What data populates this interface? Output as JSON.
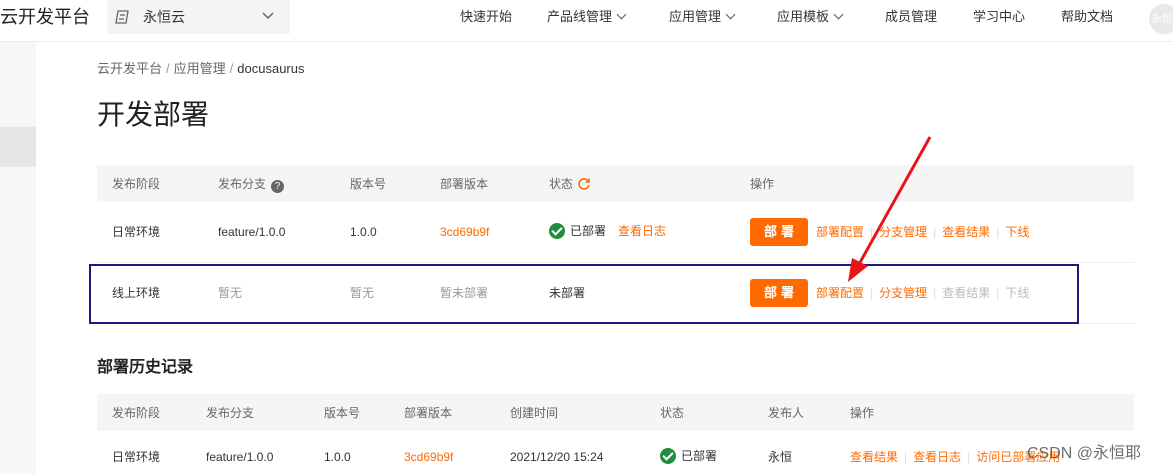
{
  "topbar": {
    "brand": "云开发平台",
    "tenant": "永恒云",
    "nav": [
      {
        "label": "快速开始",
        "has_menu": false
      },
      {
        "label": "产品线管理",
        "has_menu": true
      },
      {
        "label": "应用管理",
        "has_menu": true
      },
      {
        "label": "应用模板",
        "has_menu": true
      },
      {
        "label": "成员管理",
        "has_menu": false
      },
      {
        "label": "学习中心",
        "has_menu": false
      },
      {
        "label": "帮助文档",
        "has_menu": false
      }
    ],
    "avatar": "永恒"
  },
  "breadcrumb": {
    "items": [
      "云开发平台",
      "应用管理",
      "docusaurus"
    ],
    "separator": "/"
  },
  "page_title": "开发部署",
  "deploy_table": {
    "headers": [
      "发布阶段",
      "发布分支",
      "版本号",
      "部署版本",
      "状态",
      "操作"
    ],
    "rows": [
      {
        "stage": "日常环境",
        "branch": "feature/1.0.0",
        "version": "1.0.0",
        "deploy_version": "3cd69b9f",
        "status": "已部署",
        "status_link": "查看日志",
        "deploy_button": "部署",
        "actions": [
          "部署配置",
          "分支管理",
          "查看结果",
          "下线"
        ]
      },
      {
        "stage": "线上环境",
        "branch": "暂无",
        "version": "暂无",
        "deploy_version": "暂未部署",
        "status": "未部署",
        "deploy_button": "部署",
        "actions": [
          "部署配置",
          "分支管理",
          "查看结果",
          "下线"
        ]
      }
    ]
  },
  "history": {
    "title": "部署历史记录",
    "headers": [
      "发布阶段",
      "发布分支",
      "版本号",
      "部署版本",
      "创建时间",
      "状态",
      "发布人",
      "操作"
    ],
    "rows": [
      {
        "stage": "日常环境",
        "branch": "feature/1.0.0",
        "version": "1.0.0",
        "deploy_version": "3cd69b9f",
        "created": "2021/12/20 15:24",
        "status": "已部署",
        "publisher": "永恒",
        "actions": [
          "查看结果",
          "查看日志",
          "访问已部署应用"
        ]
      }
    ]
  },
  "watermark": "CSDN @永恒耶",
  "colors": {
    "accent": "#ff6a00",
    "success": "#1e8e3e",
    "highlight_border": "#1a1a7a",
    "annotation_arrow": "#e8141c"
  }
}
